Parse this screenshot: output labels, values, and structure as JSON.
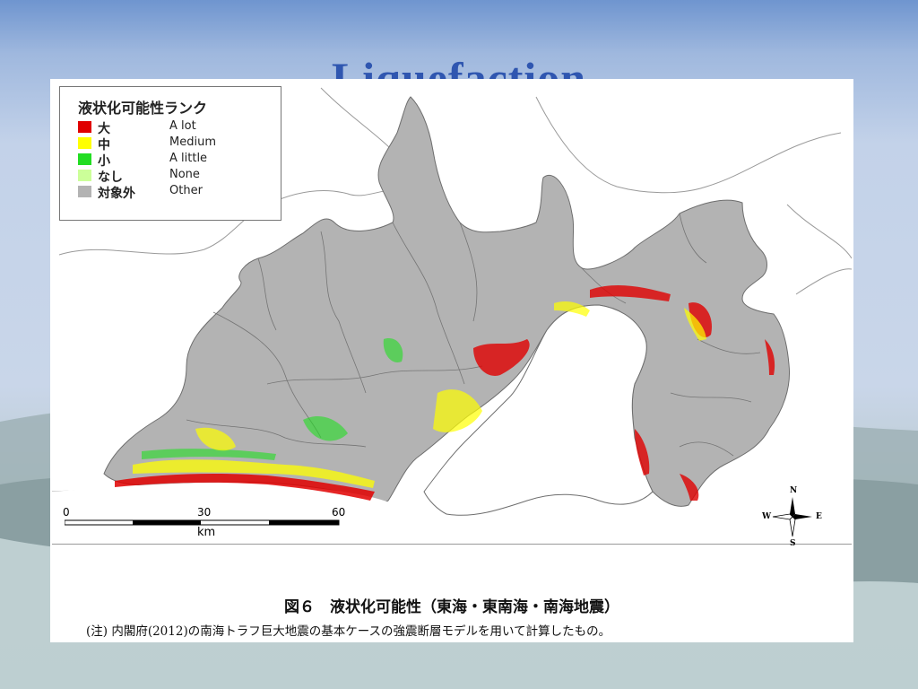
{
  "slide": {
    "title": "Liquefaction",
    "colors": {
      "title": "#2f56b0",
      "background_top": "#6f95cf",
      "background_mid": "#c9d6e9"
    }
  },
  "legend": {
    "title": "液状化可能性ランク",
    "items": [
      {
        "jp": "大",
        "en": "A lot",
        "color": "#e00000"
      },
      {
        "jp": "中",
        "en": "Medium",
        "color": "#ffff00"
      },
      {
        "jp": "小",
        "en": "A little",
        "color": "#22dd22"
      },
      {
        "jp": "なし",
        "en": "None",
        "color": "#ccff99"
      },
      {
        "jp": "対象外",
        "en": "Other",
        "color": "#b3b3b3"
      }
    ]
  },
  "scale_bar": {
    "ticks": [
      "0",
      "30",
      "60"
    ],
    "unit": "km"
  },
  "compass": {
    "n": "N",
    "s": "S",
    "e": "E",
    "w": "W"
  },
  "caption": {
    "title": "図６　液状化可能性（東海・東南海・南海地震）",
    "note": "(注) 内閣府(2012)の南海トラフ巨大地震の基本ケースの強震断層モデルを用いて計算したもの。"
  }
}
